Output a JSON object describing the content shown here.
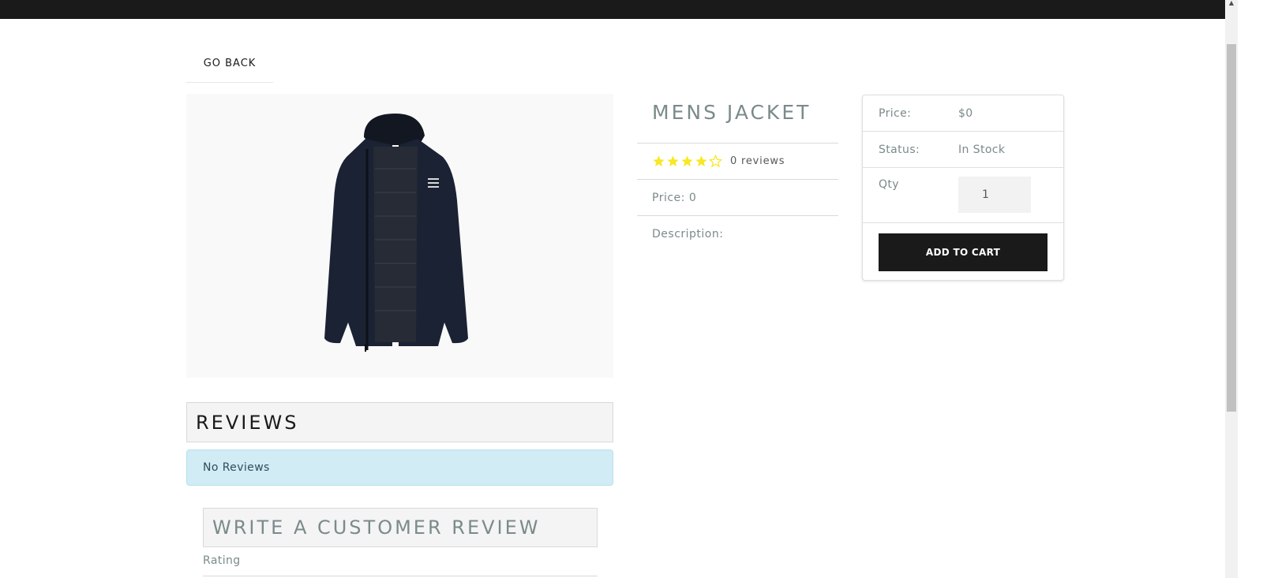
{
  "nav": {
    "back_label": "GO BACK"
  },
  "product": {
    "name": "MENS JACKET",
    "image_alt": "Mens Jacket",
    "rating_value": 4,
    "rating_max": 5,
    "reviews_text": "0 reviews",
    "price_text": "Price: 0",
    "description_text": "Description:"
  },
  "cart": {
    "price_label": "Price:",
    "price_value": "$0",
    "status_label": "Status:",
    "status_value": "In Stock",
    "qty_label": "Qty",
    "qty_value": "1",
    "add_button_label": "ADD TO CART"
  },
  "reviews": {
    "heading": "REVIEWS",
    "empty_message": "No Reviews",
    "write_heading": "WRITE A CUSTOMER REVIEW",
    "rating_label": "Rating"
  },
  "colors": {
    "star_fill": "#f8e825",
    "topbar": "#1a1a1a",
    "button": "#1a1a1a",
    "info_alert": "#d1ecf5"
  },
  "icons": {
    "star_full": "star-icon",
    "star_empty": "star-outline-icon"
  }
}
